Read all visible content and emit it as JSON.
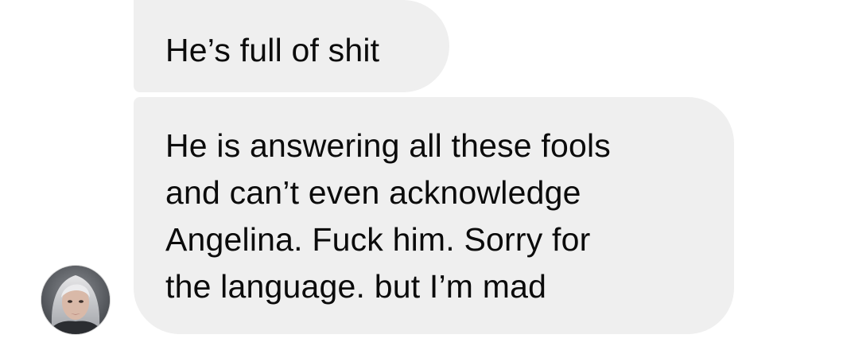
{
  "conversation": {
    "messages": [
      {
        "text": "He’s full of shit"
      },
      {
        "text": "He is answering all these fools\nand can’t even acknowledge\nAngelina. Fuck him. Sorry for\nthe language. but I’m mad"
      }
    ],
    "sender": {
      "avatar": "profile-photo"
    }
  },
  "colors": {
    "bubble": "#efefef",
    "text": "#0b0b0b",
    "background": "#ffffff"
  }
}
